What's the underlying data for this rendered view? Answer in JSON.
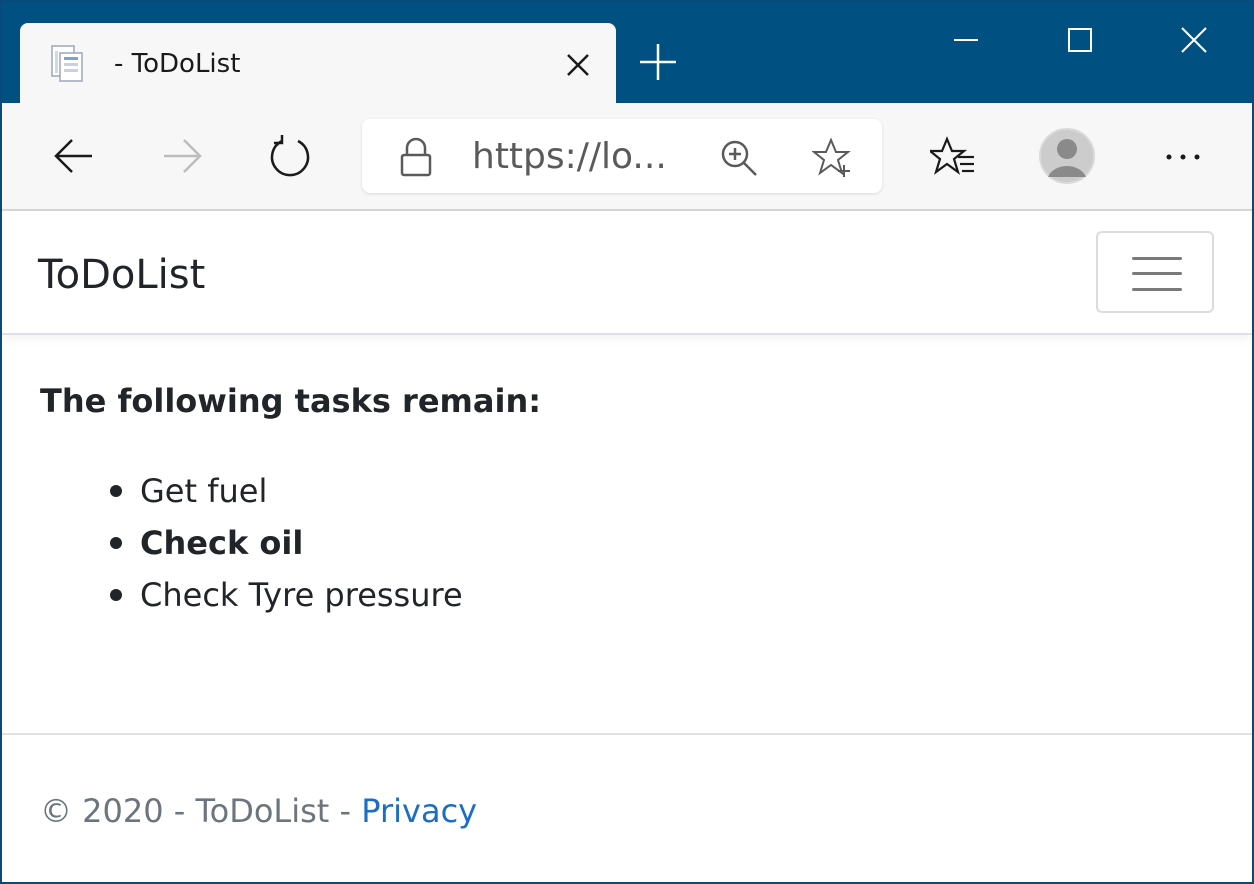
{
  "browser": {
    "tab": {
      "title": "- ToDoList"
    },
    "address_bar": {
      "url": "https://lo..."
    }
  },
  "site": {
    "brand": "ToDoList",
    "heading": "The following tasks remain:",
    "tasks": [
      {
        "text": "Get fuel",
        "bold": false
      },
      {
        "text": "Check oil",
        "bold": true
      },
      {
        "text": "Check Tyre pressure",
        "bold": false
      }
    ],
    "footer": {
      "prefix": "© 2020 - ToDoList - ",
      "privacy_label": "Privacy"
    }
  },
  "colors": {
    "title_bar": "#005082",
    "toolbar": "#f7f7f7",
    "link": "#1b6ec2",
    "footer_text": "#6c757d"
  }
}
